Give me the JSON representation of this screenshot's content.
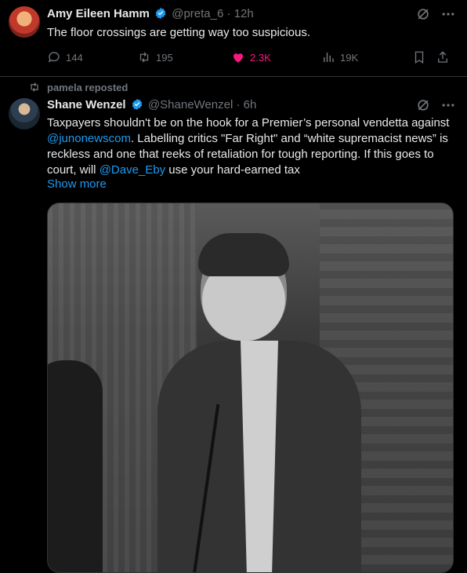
{
  "tweet1": {
    "name": "Amy Eileen Hamm",
    "handle": "@preta_6",
    "dot": "·",
    "time": "12h",
    "text": "The floor crossings are getting way too suspicious.",
    "replies": "144",
    "reposts": "195",
    "likes": "2.3K",
    "views": "19K"
  },
  "repost_label": "pamela reposted",
  "tweet2": {
    "name": "Shane Wenzel",
    "handle": "@ShaneWenzel",
    "dot": "·",
    "time": "6h",
    "text_1": "Taxpayers shouldn't be on the hook for a Premier’s personal vendetta against ",
    "mention_1": "@junonewscom",
    "text_2": ". Labelling critics \"Far Right\" and “white supremacist news” is reckless and one that reeks of retaliation for tough reporting. If this goes to court, will ",
    "mention_2": "@Dave_Eby",
    "text_3": " use your hard-earned tax",
    "show_more": "Show more"
  },
  "colors": {
    "accent": "#1d9bf0",
    "like": "#f91880",
    "muted": "#71767b"
  },
  "icons": [
    "verified-icon",
    "grok-icon",
    "more-icon",
    "reply-icon",
    "repost-icon",
    "like-icon",
    "views-icon",
    "bookmark-icon",
    "share-icon"
  ]
}
